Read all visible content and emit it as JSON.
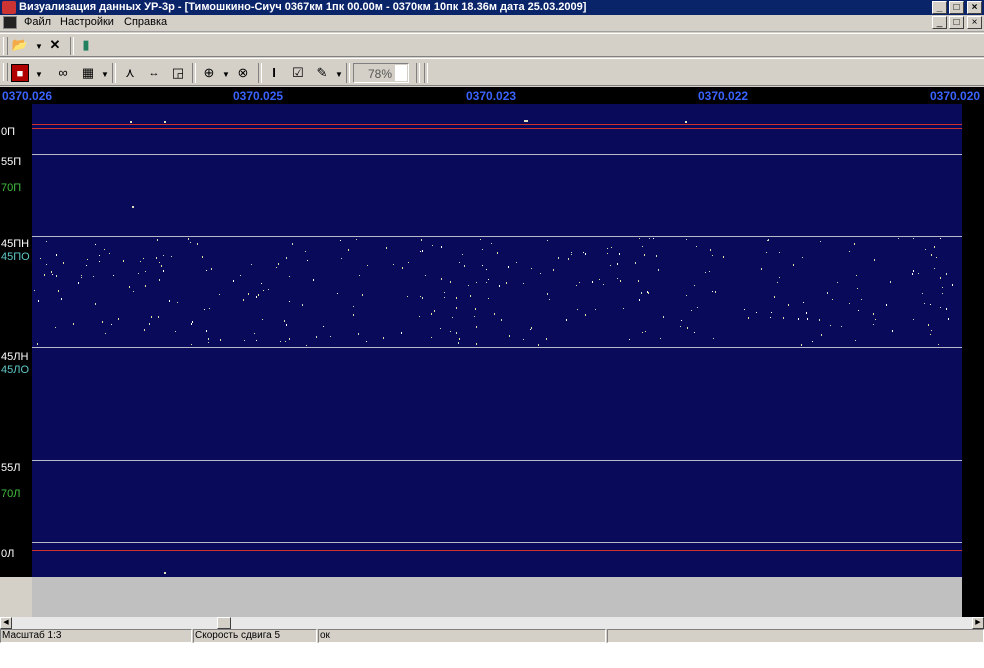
{
  "window": {
    "title": "Визуализация данных УР-3р - [Тимошкино-Сиуч 0367км 1пк 00.00м - 0370км 10пк 18.36м дата 25.03.2009]"
  },
  "menu": {
    "items": [
      "Файл",
      "Настройки",
      "Справка"
    ]
  },
  "toolbar": {
    "zoom_value": "78%"
  },
  "ruler": {
    "labels": [
      "0370.026",
      "0370.025",
      "0370.023",
      "0370.022",
      "0370.020"
    ]
  },
  "channels": [
    {
      "label": "0П",
      "color": "#ffffff"
    },
    {
      "label": "55П",
      "color": "#ffffff"
    },
    {
      "label": "70П",
      "color": "#40c040"
    },
    {
      "label": "45ПН",
      "color": "#ffffff"
    },
    {
      "label": "45ПО",
      "color": "#60c8c8"
    },
    {
      "label": "45ЛН",
      "color": "#ffffff"
    },
    {
      "label": "45ЛО",
      "color": "#60c8c8"
    },
    {
      "label": "55Л",
      "color": "#ffffff"
    },
    {
      "label": "70Л",
      "color": "#40c040"
    },
    {
      "label": "0Л",
      "color": "#ffffff"
    }
  ],
  "colors": {
    "plot_background": "#0a0a5a",
    "ruler_text": "#3a63ff",
    "threshold_line": "#d03030",
    "title_bar": "#0a246a"
  },
  "statusbar": {
    "scale": "Масштаб 1:3",
    "shift_speed": "Скорость сдвига 5",
    "status": "ок"
  }
}
